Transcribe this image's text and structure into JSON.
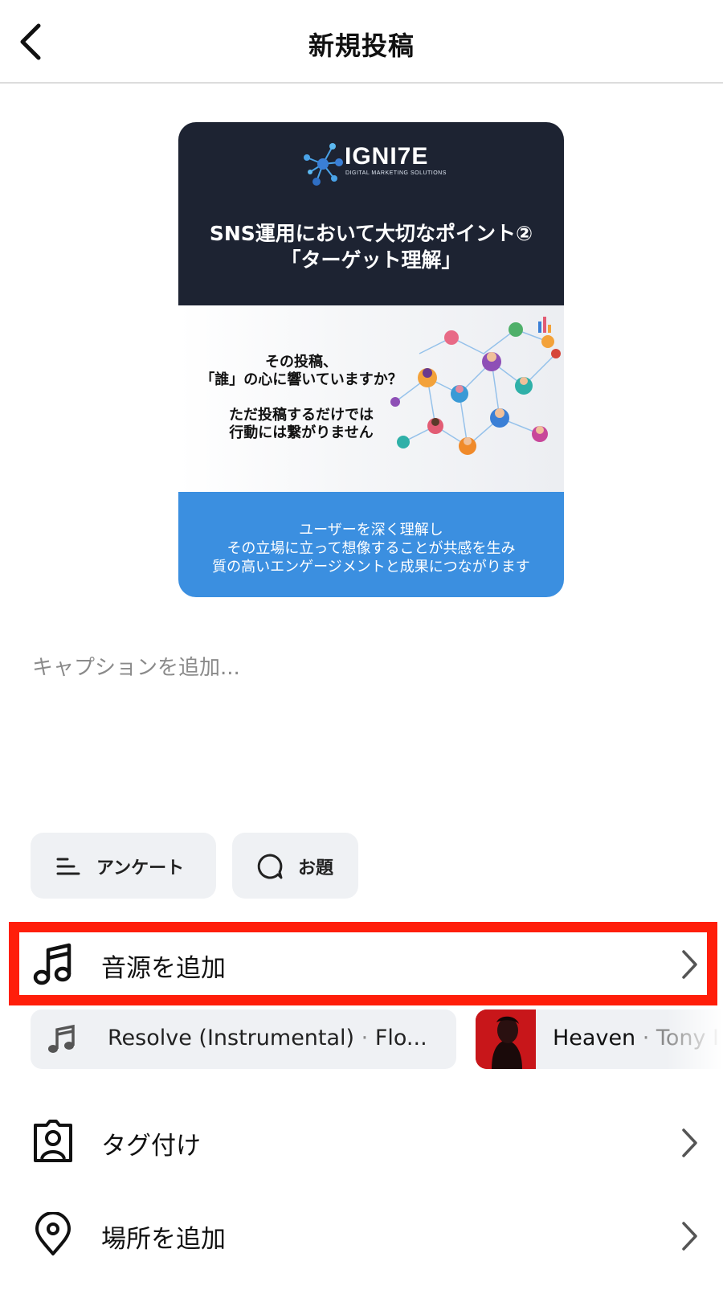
{
  "header": {
    "title": "新規投稿"
  },
  "post": {
    "logo": {
      "text": "IGNI7E",
      "subtitle": "DIGITAL MARKETING SOLUTIONS"
    },
    "headline": [
      "SNS運用において大切なポイント②",
      "「ターゲット理解」"
    ],
    "middle_text": [
      "その投稿、",
      "「誰」の心に響いていますか？",
      "ただ投稿するだけでは",
      "行動には繋がりません"
    ],
    "bottom_text": [
      "ユーザーを深く理解し",
      "その立場に立って想像することが共感を生み",
      "質の高いエンゲージメントと成果につながります"
    ]
  },
  "caption": {
    "placeholder": "キャプションを追加..."
  },
  "chips": {
    "survey": "アンケート",
    "topic": "お題"
  },
  "add_music": {
    "label": "音源を追加"
  },
  "music_suggestions": [
    {
      "title": "Resolve (Instrumental)",
      "sep": " · ",
      "artist": "Flo..."
    },
    {
      "title": "Heaven",
      "sep": " · ",
      "artist": "Tony I"
    }
  ],
  "tag_people": {
    "label": "タグ付け"
  },
  "add_location": {
    "label": "場所を追加"
  },
  "colors": {
    "highlight": "#ff1e0a",
    "preview_dark": "#1d2332",
    "preview_blue": "#3b8fe0",
    "chip_bg": "#eff1f4"
  }
}
